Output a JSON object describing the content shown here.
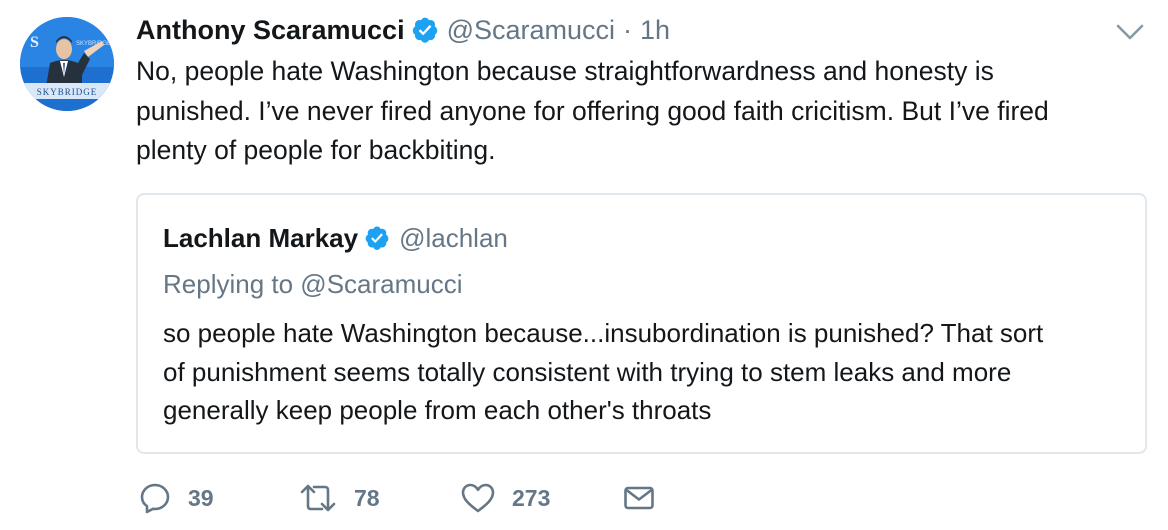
{
  "tweet": {
    "author_name": "Anthony Scaramucci",
    "author_handle": "@Scaramucci",
    "separator": "·",
    "timestamp": "1h",
    "text": "No, people hate Washington because straightforwardness and honesty is\npunished. I’ve never fired anyone for offering good faith cricitism. But I’ve fired\nplenty of people for backbiting.",
    "avatar_banner_text": "SKYBRIDGE"
  },
  "quoted_tweet": {
    "author_name": "Lachlan Markay",
    "author_handle": "@lachlan",
    "replying_to": "Replying to @Scaramucci",
    "text": "so people hate Washington because...insubordination is punished? That sort\nof punishment seems totally consistent with trying to stem leaks and more\ngenerally keep people from each other's throats"
  },
  "actions": {
    "reply_count": "39",
    "retweet_count": "78",
    "like_count": "273"
  },
  "icons": {
    "verified": "verified-badge-icon",
    "caret": "chevron-down-icon",
    "reply": "reply-icon",
    "retweet": "retweet-icon",
    "like": "heart-icon",
    "dm": "envelope-icon"
  },
  "colors": {
    "text": "#14171a",
    "secondary": "#657786",
    "verified_blue": "#1da1f2",
    "border": "#e1e8ed"
  }
}
